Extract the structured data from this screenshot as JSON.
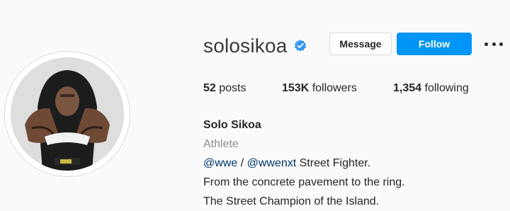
{
  "profile": {
    "username": "solosikoa",
    "verified_color": "#3897f0",
    "actions": {
      "message_label": "Message",
      "follow_label": "Follow",
      "more_icon": "more-horizontal-icon"
    },
    "stats": {
      "posts_count": "52",
      "posts_label": "posts",
      "followers_count": "153K",
      "followers_label": "followers",
      "following_count": "1,354",
      "following_label": "following"
    },
    "bio": {
      "name": "Solo Sikoa",
      "category": "Athlete",
      "mention1": "@wwe",
      "separator": " / ",
      "mention2": "@wwenxt",
      "line1_rest": " Street Fighter.",
      "line2": "From the concrete pavement to the ring.",
      "line3": "The Street Champion of the Island."
    }
  },
  "colors": {
    "follow_button": "#0095f6",
    "mention": "#00376b",
    "muted": "#8e8e8e"
  }
}
